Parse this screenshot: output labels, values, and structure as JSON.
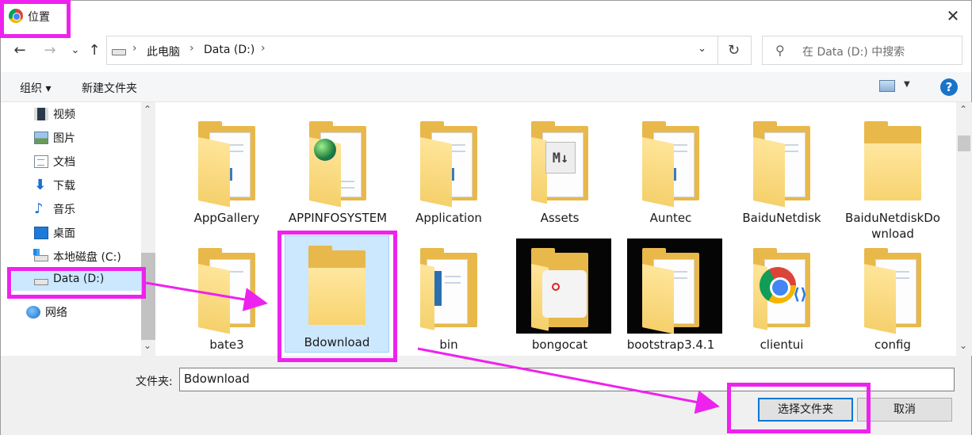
{
  "window": {
    "title": "位置",
    "close_glyph": "✕"
  },
  "nav": {
    "back_glyph": "←",
    "forward_glyph": "→",
    "recent_glyph": "⌄",
    "up_glyph": "↑"
  },
  "address": {
    "crumbs": [
      "此电脑",
      "Data (D:)"
    ],
    "separator": "›",
    "dropdown_glyph": "⌄",
    "refresh_glyph": "↻"
  },
  "search": {
    "placeholder": "在 Data (D:) 中搜索",
    "icon_glyph": "⚲"
  },
  "toolbar": {
    "organize_label": "组织 ▾",
    "new_folder_label": "新建文件夹",
    "view_dropdown_glyph": "▼",
    "help_glyph": "?"
  },
  "sidebar": {
    "items": [
      {
        "label": "视频",
        "icon": "video-icon"
      },
      {
        "label": "图片",
        "icon": "pictures-icon"
      },
      {
        "label": "文档",
        "icon": "documents-icon"
      },
      {
        "label": "下载",
        "icon": "download-icon"
      },
      {
        "label": "音乐",
        "icon": "music-icon"
      },
      {
        "label": "桌面",
        "icon": "desktop-icon"
      },
      {
        "label": "本地磁盘 (C:)",
        "icon": "drive-c-icon"
      },
      {
        "label": "Data (D:)",
        "icon": "drive-d-icon",
        "selected": true
      },
      {
        "label": "网络",
        "icon": "network-icon"
      }
    ],
    "glyphs": {
      "down": "⬇",
      "music": "♪"
    },
    "scroll_up": "⌃",
    "scroll_down": "⌄"
  },
  "files": [
    {
      "name": "AppGallery",
      "kind": "folder"
    },
    {
      "name": "APPINFOSYSTEM",
      "kind": "folder-web"
    },
    {
      "name": "Application",
      "kind": "folder"
    },
    {
      "name": "Assets",
      "kind": "folder-md"
    },
    {
      "name": "Auntec",
      "kind": "folder"
    },
    {
      "name": "BaiduNetdisk",
      "kind": "folder"
    },
    {
      "name": "BaiduNetdiskDownload",
      "kind": "folder-empty"
    },
    {
      "name": "bate3",
      "kind": "folder"
    },
    {
      "name": "Bdownload",
      "kind": "folder-empty",
      "selected": true
    },
    {
      "name": "bin",
      "kind": "folder"
    },
    {
      "name": "bongocat",
      "kind": "folder-dark"
    },
    {
      "name": "bootstrap3.4.1",
      "kind": "folder-dark"
    },
    {
      "name": "clientui",
      "kind": "folder-chrome"
    },
    {
      "name": "config",
      "kind": "folder"
    }
  ],
  "file_glyphs": {
    "markdown": "M↓",
    "vscode": "⟨⟩"
  },
  "main_scroll": {
    "up": "⌃",
    "down": "⌄"
  },
  "footer": {
    "folder_label": "文件夹:",
    "folder_value": "Bdownload",
    "select_button": "选择文件夹",
    "cancel_button": "取消"
  },
  "colors": {
    "highlight": "#ee22ee",
    "selection": "#cce8ff",
    "accent": "#0078d7"
  }
}
